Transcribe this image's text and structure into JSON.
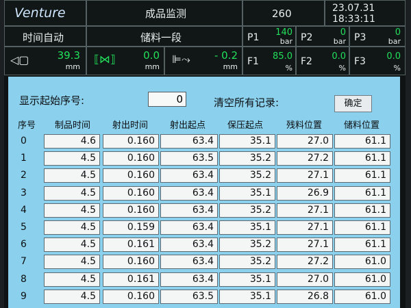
{
  "header": {
    "brand": "Venture",
    "title": "成品监测",
    "count": "260",
    "date": "23.07.31",
    "time": "18:33:11",
    "mode": "时间自动",
    "stage": "储料一段"
  },
  "readings": {
    "p1": {
      "label": "P1",
      "value": "140",
      "unit": "bar"
    },
    "p2": {
      "label": "P2",
      "value": "0",
      "unit": "bar"
    },
    "p3": {
      "label": "P3",
      "value": "0",
      "unit": "bar"
    },
    "f1": {
      "label": "F1",
      "value": "85.0",
      "unit": "%"
    },
    "f2": {
      "label": "F2",
      "value": "0.0",
      "unit": "%"
    },
    "f3": {
      "label": "F3",
      "value": "0.0",
      "unit": "%"
    }
  },
  "gauges": [
    {
      "value": "39.3",
      "unit": "mm"
    },
    {
      "value": "0.0",
      "unit": "mm"
    },
    {
      "value": "- 0.2",
      "unit": "mm"
    }
  ],
  "controls": {
    "start_label": "显示起始序号:",
    "start_value": "0",
    "clear_label": "清空所有记录:",
    "confirm_label": "确定"
  },
  "table": {
    "columns": [
      "序号",
      "制品时间",
      "射出时间",
      "射出起点",
      "保压起点",
      "残料位置",
      "储料位置"
    ],
    "rows": [
      [
        "0",
        "4.6",
        "0.160",
        "63.4",
        "35.1",
        "27.0",
        "61.1"
      ],
      [
        "1",
        "4.5",
        "0.160",
        "63.5",
        "35.2",
        "27.2",
        "61.1"
      ],
      [
        "2",
        "4.5",
        "0.160",
        "63.4",
        "35.2",
        "27.1",
        "61.1"
      ],
      [
        "3",
        "4.5",
        "0.160",
        "63.4",
        "35.1",
        "26.9",
        "61.1"
      ],
      [
        "4",
        "4.5",
        "0.160",
        "63.4",
        "35.2",
        "27.1",
        "61.1"
      ],
      [
        "5",
        "4.5",
        "0.159",
        "63.4",
        "35.1",
        "27.1",
        "61.1"
      ],
      [
        "6",
        "4.5",
        "0.161",
        "63.4",
        "35.2",
        "27.1",
        "61.1"
      ],
      [
        "7",
        "4.5",
        "0.160",
        "63.4",
        "35.2",
        "27.2",
        "61.0"
      ],
      [
        "8",
        "4.5",
        "0.161",
        "63.4",
        "35.1",
        "27.0",
        "61.0"
      ],
      [
        "9",
        "4.5",
        "0.160",
        "63.5",
        "35.1",
        "26.8",
        "61.0"
      ]
    ]
  }
}
